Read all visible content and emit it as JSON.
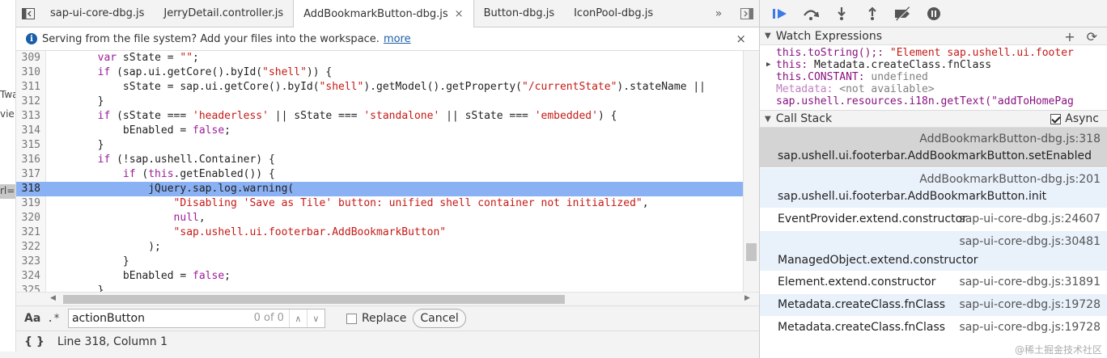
{
  "left_strip": {
    "fragments": [
      "Twa",
      "vie",
      "rl=\""
    ]
  },
  "source": {
    "tabs": [
      {
        "label": "sap-ui-core-dbg.js",
        "active": false
      },
      {
        "label": "JerryDetail.controller.js",
        "active": false
      },
      {
        "label": "AddBookmarkButton-dbg.js",
        "active": true,
        "close": "×"
      },
      {
        "label": "Button-dbg.js",
        "active": false
      },
      {
        "label": "IconPool-dbg.js",
        "active": false
      }
    ],
    "more_tabs": "»",
    "infobar": {
      "text": "Serving from the file system? Add your files into the workspace.",
      "link": "more",
      "close": "×"
    },
    "lines": [
      {
        "n": "309",
        "code": [
          [
            "",
            "        "
          ],
          [
            "kw",
            "var"
          ],
          [
            "",
            " sState = "
          ],
          [
            "str",
            "\"\""
          ],
          [
            "",
            ";"
          ]
        ]
      },
      {
        "n": "310",
        "code": [
          [
            "",
            "        "
          ],
          [
            "kw",
            "if"
          ],
          [
            "",
            " (sap.ui.getCore().byId("
          ],
          [
            "str",
            "\"shell\""
          ],
          [
            "",
            ")) {"
          ]
        ]
      },
      {
        "n": "311",
        "code": [
          [
            "",
            "            sState = sap.ui.getCore().byId("
          ],
          [
            "str",
            "\"shell\""
          ],
          [
            "",
            ").getModel().getProperty("
          ],
          [
            "str",
            "\"/currentState\""
          ],
          [
            "",
            ").stateName ||"
          ]
        ]
      },
      {
        "n": "312",
        "code": [
          [
            "",
            "        }"
          ]
        ]
      },
      {
        "n": "313",
        "code": [
          [
            "",
            "        "
          ],
          [
            "kw",
            "if"
          ],
          [
            "",
            " (sState === "
          ],
          [
            "str",
            "'headerless'"
          ],
          [
            "",
            " || sState === "
          ],
          [
            "str",
            "'standalone'"
          ],
          [
            "",
            " || sState === "
          ],
          [
            "str",
            "'embedded'"
          ],
          [
            "",
            ") {"
          ]
        ]
      },
      {
        "n": "314",
        "code": [
          [
            "",
            "            bEnabled = "
          ],
          [
            "kw",
            "false"
          ],
          [
            "",
            ";"
          ]
        ]
      },
      {
        "n": "315",
        "code": [
          [
            "",
            "        }"
          ]
        ]
      },
      {
        "n": "316",
        "code": [
          [
            "",
            "        "
          ],
          [
            "kw",
            "if"
          ],
          [
            "",
            " (!sap.ushell.Container) {"
          ]
        ]
      },
      {
        "n": "317",
        "code": [
          [
            "",
            "            "
          ],
          [
            "kw",
            "if"
          ],
          [
            "",
            " ("
          ],
          [
            "kw",
            "this"
          ],
          [
            "",
            ".getEnabled()) {"
          ]
        ]
      },
      {
        "n": "318",
        "code": [
          [
            "",
            "                jQuery.sap.log.warning("
          ]
        ],
        "highlight": true
      },
      {
        "n": "319",
        "code": [
          [
            "",
            "                    "
          ],
          [
            "str",
            "\"Disabling 'Save as Tile' button: unified shell container not initialized\""
          ],
          [
            "",
            ","
          ]
        ]
      },
      {
        "n": "320",
        "code": [
          [
            "",
            "                    "
          ],
          [
            "kw",
            "null"
          ],
          [
            "",
            ","
          ]
        ]
      },
      {
        "n": "321",
        "code": [
          [
            "",
            "                    "
          ],
          [
            "str",
            "\"sap.ushell.ui.footerbar.AddBookmarkButton\""
          ]
        ]
      },
      {
        "n": "322",
        "code": [
          [
            "",
            "                );"
          ]
        ]
      },
      {
        "n": "323",
        "code": [
          [
            "",
            "            }"
          ]
        ]
      },
      {
        "n": "324",
        "code": [
          [
            "",
            "            bEnabled = "
          ],
          [
            "kw",
            "false"
          ],
          [
            "",
            ";"
          ]
        ]
      },
      {
        "n": "325",
        "code": [
          [
            "",
            "        }"
          ]
        ]
      }
    ],
    "search": {
      "case_label": "Aa",
      "regex_label": ".*",
      "query": "actionButton",
      "match_count": "0 of 0",
      "replace_label": "Replace",
      "cancel_label": "Cancel"
    },
    "status": {
      "braces": "{ }",
      "position": "Line 318, Column 1"
    }
  },
  "debugger": {
    "watch": {
      "title": "Watch Expressions",
      "add": "+",
      "refresh": "⟳",
      "items": [
        {
          "name": "this.toString();",
          "sep": ": ",
          "value": "\"Element sap.ushell.ui.footer",
          "vclass": "sv",
          "expandable": false
        },
        {
          "name": "this",
          "sep": ": ",
          "value": "Metadata.createClass.fnClass",
          "vclass": "vl",
          "expandable": true
        },
        {
          "name": "this.CONSTANT",
          "sep": ": ",
          "value": "undefined",
          "vclass": "un",
          "expandable": false
        },
        {
          "name": "Metadata",
          "sep": ": ",
          "value": "<not available>",
          "vclass": "un",
          "expandable": false,
          "dim": true
        },
        {
          "name": "sap.ushell.resources.i18n.getText(\"addToHomePag",
          "sep": "",
          "value": "",
          "vclass": "vl",
          "expandable": false
        }
      ]
    },
    "callstack": {
      "title": "Call Stack",
      "async_label": "Async",
      "frames": [
        {
          "fn": "sap.ushell.ui.footerbar.AddBookmarkButton.setEnabled",
          "loc": "AddBookmarkButton-dbg.js:318",
          "layout": "two",
          "style": "sel"
        },
        {
          "fn": "sap.ushell.ui.footerbar.AddBookmarkButton.init",
          "loc": "AddBookmarkButton-dbg.js:201",
          "layout": "two",
          "style": "alt"
        },
        {
          "fn": "EventProvider.extend.constructor",
          "loc": "sap-ui-core-dbg.js:24607",
          "layout": "one",
          "style": ""
        },
        {
          "fn": "ManagedObject.extend.constructor",
          "loc": "sap-ui-core-dbg.js:30481",
          "layout": "split",
          "style": "alt"
        },
        {
          "fn": "Element.extend.constructor",
          "loc": "sap-ui-core-dbg.js:31891",
          "layout": "one",
          "style": ""
        },
        {
          "fn": "Metadata.createClass.fnClass",
          "loc": "sap-ui-core-dbg.js:19728",
          "layout": "one",
          "style": "alt"
        },
        {
          "fn": "Metadata.createClass.fnClass",
          "loc": "sap-ui-core-dbg.js:19728",
          "layout": "one",
          "style": ""
        }
      ]
    },
    "watermark": "@稀土掘金技术社区"
  }
}
